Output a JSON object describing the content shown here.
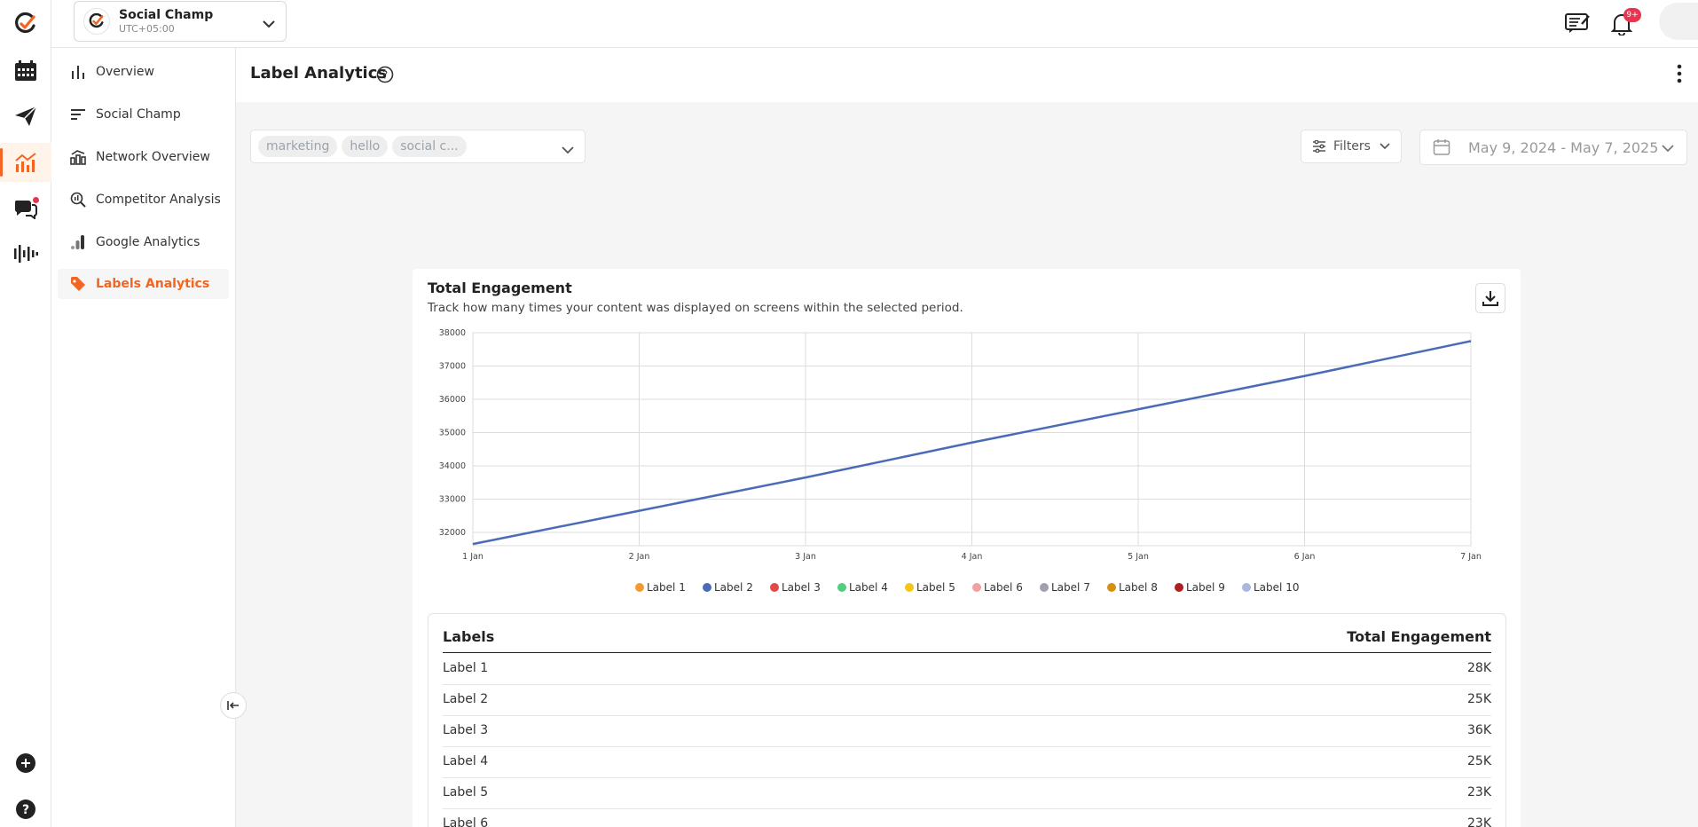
{
  "workspace": {
    "name": "Social Champ",
    "timezone": "UTC+05:00"
  },
  "header": {
    "notification_badge": "9+"
  },
  "sidebar": {
    "items": [
      {
        "label": "Overview",
        "icon": "bar-chart-icon"
      },
      {
        "label": "Social Champ",
        "icon": "horizontal-bars-icon"
      },
      {
        "label": "Network Overview",
        "icon": "building-chart-icon"
      },
      {
        "label": "Competitor Analysis",
        "icon": "magnifier-chart-icon"
      },
      {
        "label": "Google Analytics",
        "icon": "google-analytics-icon"
      },
      {
        "label": "Labels Analytics",
        "icon": "tag-icon",
        "active": true
      }
    ]
  },
  "page": {
    "title": "Label Analytics"
  },
  "filters": {
    "labels": [
      "marketing",
      "hello",
      "social c..."
    ],
    "filters_label": "Filters",
    "date_range": "May 9, 2024 - May 7, 2025"
  },
  "card": {
    "title": "Total Engagement",
    "description": "Track how many times your content was displayed on screens within the selected period."
  },
  "colors": {
    "accent": "#f26522",
    "line": "#4a6bb7",
    "grid": "#dcdcdc"
  },
  "chart_data": {
    "type": "line",
    "title": "Total Engagement",
    "x": [
      "1 Jan",
      "2 Jan",
      "3 Jan",
      "4 Jan",
      "5 Jan",
      "6 Jan",
      "7 Jan"
    ],
    "ylim": [
      31600,
      38000
    ],
    "yticks": [
      32000,
      33000,
      34000,
      35000,
      36000,
      37000,
      38000
    ],
    "grid": true,
    "legend_position": "bottom",
    "series": [
      {
        "name": "Label 2",
        "color": "#4a6bb7",
        "values": [
          31650,
          32650,
          33650,
          34700,
          35700,
          36700,
          37750
        ]
      }
    ],
    "legend": [
      {
        "name": "Label 1",
        "color": "#f59a2f"
      },
      {
        "name": "Label 2",
        "color": "#4a6bb7"
      },
      {
        "name": "Label 3",
        "color": "#e04a4a"
      },
      {
        "name": "Label 4",
        "color": "#4fcf7f"
      },
      {
        "name": "Label 5",
        "color": "#f5c518"
      },
      {
        "name": "Label 6",
        "color": "#f3a0a0"
      },
      {
        "name": "Label 7",
        "color": "#a0a0b0"
      },
      {
        "name": "Label 8",
        "color": "#d4900e"
      },
      {
        "name": "Label 9",
        "color": "#b01e1e"
      },
      {
        "name": "Label 10",
        "color": "#a9b8e0"
      }
    ]
  },
  "table": {
    "headers": [
      "Labels",
      "Total Engagement"
    ],
    "rows": [
      {
        "label": "Label 1",
        "value": "28K"
      },
      {
        "label": "Label 2",
        "value": "25K"
      },
      {
        "label": "Label 3",
        "value": "36K"
      },
      {
        "label": "Label 4",
        "value": "25K"
      },
      {
        "label": "Label 5",
        "value": "23K"
      },
      {
        "label": "Label 6",
        "value": "23K"
      }
    ]
  }
}
